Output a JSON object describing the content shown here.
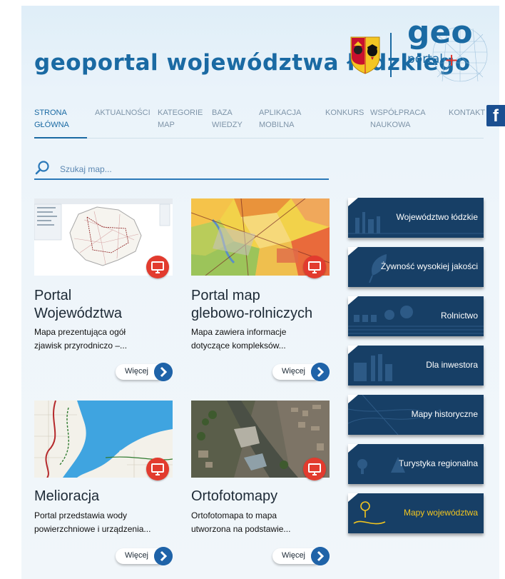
{
  "header": {
    "title": "geoportal województwa łódzkiego",
    "logo_geo": "geo",
    "logo_portal": "portal",
    "logo_plus": "+"
  },
  "nav": {
    "items": [
      {
        "label_line1": "STRONA",
        "label_line2": "GŁÓWNA"
      },
      {
        "label_line1": "AKTUALNOŚCI",
        "label_line2": ""
      },
      {
        "label_line1": "KATEGORIE",
        "label_line2": "MAP"
      },
      {
        "label_line1": "BAZA",
        "label_line2": "WIEDZY"
      },
      {
        "label_line1": "APLIKACJA",
        "label_line2": "MOBILNA"
      },
      {
        "label_line1": "KONKURS",
        "label_line2": ""
      },
      {
        "label_line1": "WSPÓŁPRACA",
        "label_line2": "NAUKOWA"
      },
      {
        "label_line1": "KONTAKT",
        "label_line2": ""
      }
    ],
    "facebook": "f"
  },
  "search": {
    "placeholder": "Szukaj map..."
  },
  "cards": [
    {
      "title_line1": "Portal",
      "title_line2": "Województwa",
      "desc_line1": "Mapa prezentująca ogół",
      "desc_line2": "zjawisk przyrodniczo –...",
      "more": "Więcej"
    },
    {
      "title_line1": "Portal map",
      "title_line2": "glebowo-rolniczych",
      "desc_line1": "Mapa zawiera informacje",
      "desc_line2": "dotyczące kompleksów...",
      "more": "Więcej"
    },
    {
      "title_line1": "Melioracja",
      "title_line2": "",
      "desc_line1": "Portal przedstawia wody",
      "desc_line2": "powierzchniowe i urządzenia...",
      "more": "Więcej"
    },
    {
      "title_line1": "Ortofotomapy",
      "title_line2": "",
      "desc_line1": "Ortofotomapa to mapa",
      "desc_line2": "utworzona na podstawie...",
      "more": "Więcej"
    }
  ],
  "side_buttons": [
    {
      "label": "Województwo łódzkie"
    },
    {
      "label": "Żywność wysokiej jakości"
    },
    {
      "label": "Rolnictwo"
    },
    {
      "label": "Dla inwestora"
    },
    {
      "label": "Mapy historyczne"
    },
    {
      "label": "Turystyka regionalna"
    },
    {
      "label": "Mapy województwa"
    }
  ],
  "colors": {
    "brand_blue": "#1a6aa3",
    "side_button": "#173f66",
    "badge_red": "#e23b2e",
    "highlight_yellow": "#f2c51f"
  }
}
